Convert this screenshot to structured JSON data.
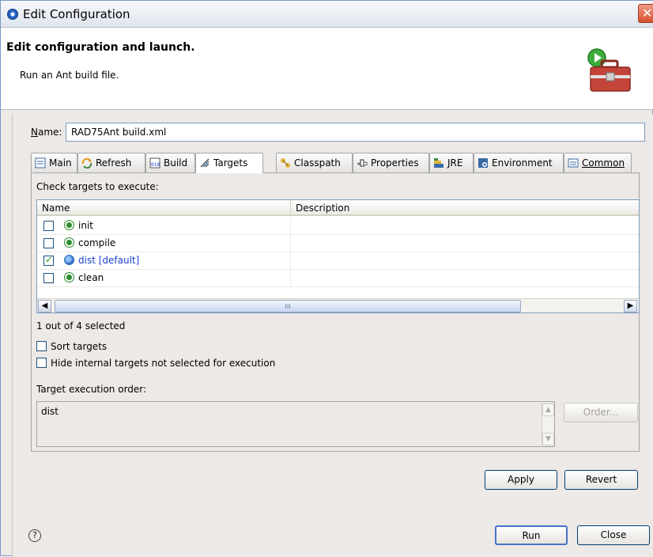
{
  "window": {
    "title": "Edit Configuration",
    "close_glyph": "✕"
  },
  "header": {
    "title": "Edit configuration and launch.",
    "subtitle": "Run an Ant build file."
  },
  "name_field": {
    "label": "Name:",
    "value": "RAD75Ant build.xml"
  },
  "tabs": [
    {
      "label": "Main",
      "icon": "main-tab-icon"
    },
    {
      "label": "Refresh",
      "icon": "refresh-icon"
    },
    {
      "label": "Build",
      "icon": "build-icon"
    },
    {
      "label": "Targets",
      "icon": "targets-icon",
      "active": true
    },
    {
      "label": "Classpath",
      "icon": "classpath-icon"
    },
    {
      "label": "Properties",
      "icon": "properties-icon"
    },
    {
      "label": "JRE",
      "icon": "jre-icon"
    },
    {
      "label": "Environment",
      "icon": "environment-icon"
    },
    {
      "label": "Common",
      "icon": "common-icon"
    }
  ],
  "targets": {
    "check_label": "Check targets to execute:",
    "columns": [
      "Name",
      "Description"
    ],
    "rows": [
      {
        "name": "init",
        "description": "",
        "checked": false
      },
      {
        "name": "compile",
        "description": "",
        "checked": false
      },
      {
        "name": "dist [default]",
        "description": "",
        "checked": true
      },
      {
        "name": "clean",
        "description": "",
        "checked": false
      }
    ],
    "selected_count": "1 out of 4 selected",
    "sort_label": "Sort targets",
    "hide_label": "Hide internal targets not selected for execution",
    "order_label": "Target execution order:",
    "order_value": "dist",
    "order_button": "Order...",
    "scroll_thumb": "III"
  },
  "buttons": {
    "apply": "Apply",
    "revert": "Revert",
    "run": "Run",
    "close": "Close"
  },
  "help_glyph": "?",
  "colors": {
    "accent": "#2a6fd6",
    "link_blue": "#1a3fd0",
    "check_green": "#21a121"
  }
}
